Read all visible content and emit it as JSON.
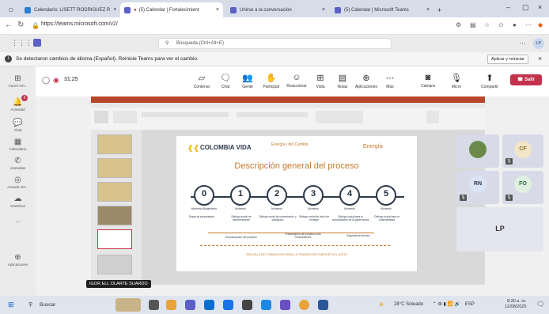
{
  "browser": {
    "tabs": [
      {
        "label": "Calendario: LISETT RODRIGUEZ R",
        "active": false
      },
      {
        "label": "(5) Calendar | Fortalecimient",
        "active": true
      },
      {
        "label": "Unirse a la conversación",
        "active": false
      },
      {
        "label": "(5) Calendar | Microsoft Teams",
        "active": false
      }
    ],
    "new_tab_label": "+",
    "url": "https://teams.microsoft.com/v2/"
  },
  "teams": {
    "search_placeholder": "Búsqueda (Ctrl+Alt+E)",
    "notification": "Se detectaron cambios de idioma (Español). Reinicie Teams para ver el cambio.",
    "notification_button": "Aplicar y reiniciar",
    "rail": [
      {
        "label": "Carrel Virt...",
        "icon": "grid-icon"
      },
      {
        "label": "Actividad",
        "icon": "bell-icon",
        "badge": "5"
      },
      {
        "label": "Chat",
        "icon": "chat-icon"
      },
      {
        "label": "Calendario",
        "icon": "calendar-icon"
      },
      {
        "label": "Llamadas",
        "icon": "phone-icon"
      },
      {
        "label": "Avanda Virt...",
        "icon": "app-icon"
      },
      {
        "label": "OneDrive",
        "icon": "cloud-icon"
      },
      {
        "label": "...",
        "icon": "more-icon"
      },
      {
        "label": "Aplicaciones",
        "icon": "apps-icon"
      }
    ],
    "meeting": {
      "timer": "31:25",
      "toolbar": [
        "Contenar",
        "Chat",
        "Gente",
        "Participar",
        "Reaccionar",
        "Vista",
        "Notas",
        "Aplicaciones",
        "Más"
      ],
      "devices": [
        "Cámara",
        "Micro",
        "Compartir"
      ],
      "leave": "Salir"
    },
    "participants": [
      {
        "initials": "",
        "photo": true
      },
      {
        "initials": "CF"
      },
      {
        "initials": "RN"
      },
      {
        "initials": "FO"
      },
      {
        "initials": "LP"
      }
    ],
    "sharer": "IGOR ELL OLARTE SUARDO"
  },
  "slide": {
    "logo": "COLOMBIA VIDA",
    "header_center": "Energía i del Cambio",
    "header_right": "Energía",
    "title": "Descripción general del proceso",
    "steps": [
      {
        "n": "0",
        "label": "Momento Alistamiento"
      },
      {
        "n": "1",
        "label": "Momento"
      },
      {
        "n": "2",
        "label": "Momento"
      },
      {
        "n": "3",
        "label": "Momento"
      },
      {
        "n": "4",
        "label": "Momento"
      },
      {
        "n": "5",
        "label": "Momento"
      }
    ],
    "descriptions": [
      "Etapa de preparatoria",
      "Diálogo social de caracterización",
      "Diálogo social de concertación y validación",
      "Diálogo social de inicio de montaje",
      "Diálogo social para la consolidación de la gobernanza",
      "Diálogo social para la sostenibilidad"
    ],
    "bottom_labels": [
      "Estructuración del proyecto",
      "Presentación del proceso a los Financiadores",
      "Seguimiento técnico"
    ],
    "footer": "ESCUELA DE FORMACIÓN PARA LA TRANSICIÓN ENERGÉTICA JUSTA"
  },
  "taskbar": {
    "search": "Buscar",
    "weather": "28°C Soleado",
    "lang": "ESP",
    "time": "8:30 a. m.",
    "date": "12/08/2025"
  },
  "colors": {
    "leave": "#c4314b",
    "accent": "#5b5fc7",
    "slide_title": "#c47a2a"
  }
}
